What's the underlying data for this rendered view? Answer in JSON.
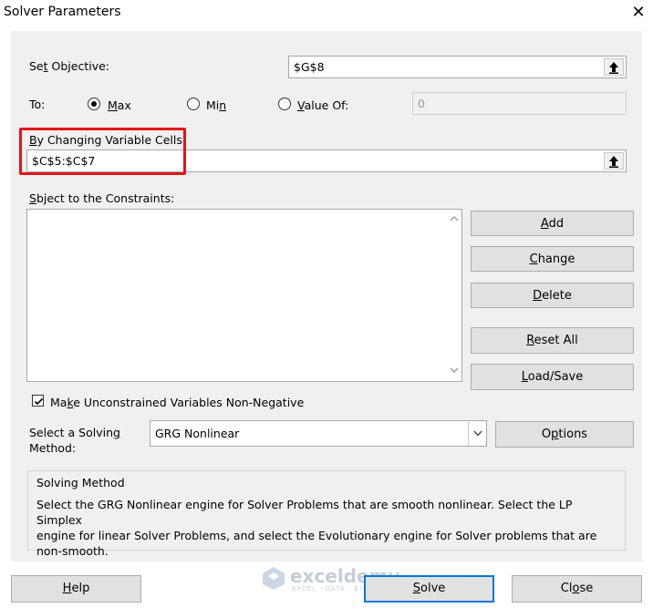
{
  "window": {
    "title": "Solver Parameters",
    "close_label": "✕"
  },
  "objective": {
    "label_pre": "Se",
    "label_key": "t",
    "label_post": " Objective:",
    "value": "$G$8"
  },
  "to": {
    "label": "To:",
    "options": [
      {
        "key": "M",
        "rest": "ax",
        "selected": true
      },
      {
        "pre": "Mi",
        "key": "n",
        "rest": "",
        "selected": false
      },
      {
        "key": "V",
        "rest": "alue Of:",
        "selected": false
      }
    ],
    "value_of": "0"
  },
  "changing": {
    "label_key": "B",
    "label_rest": "y Changing Variable Cells:",
    "value": "$C$5:$C$7"
  },
  "constraints": {
    "label_key": "U",
    "label_pre": "S",
    "label_rest": "bject to the Constraints:",
    "items": []
  },
  "side_buttons": {
    "add": {
      "key": "A",
      "rest": "dd"
    },
    "change": {
      "key": "C",
      "rest": "hange"
    },
    "delete": {
      "key": "D",
      "rest": "elete"
    },
    "reset": {
      "key": "R",
      "rest": "eset All"
    },
    "loadsave": {
      "key": "L",
      "rest": "oad/Save"
    }
  },
  "nonneg": {
    "checked": true,
    "key": "k",
    "pre": "Ma",
    "rest": "e Unconstrained Variables Non-Negative"
  },
  "method": {
    "label_line1": "Select a Solvin",
    "label_key": "g",
    "label_line2": "Method:",
    "selected": "GRG Nonlinear",
    "options_button_pre": "O",
    "options_button_key": "p",
    "options_button_rest": "tions"
  },
  "solving_method": {
    "heading": "Solving Method",
    "lines": [
      "Select the GRG Nonlinear engine for Solver Problems that are smooth nonlinear. Select the LP Simplex",
      "engine for linear Solver Problems, and select the Evolutionary engine for Solver problems that are",
      "non-smooth."
    ]
  },
  "footer": {
    "help": {
      "key": "H",
      "rest": "elp"
    },
    "solve": {
      "key": "S",
      "rest": "olve"
    },
    "close": {
      "pre": "Cl",
      "key": "o",
      "rest": "se"
    }
  },
  "watermark": {
    "brand": "exceldemy",
    "tagline": "EXCEL · DATA · BI"
  },
  "colors": {
    "highlight": "#e3141b",
    "panel": "#f0f0f0",
    "button": "#e1e1e1",
    "focus": "#0078d7"
  }
}
